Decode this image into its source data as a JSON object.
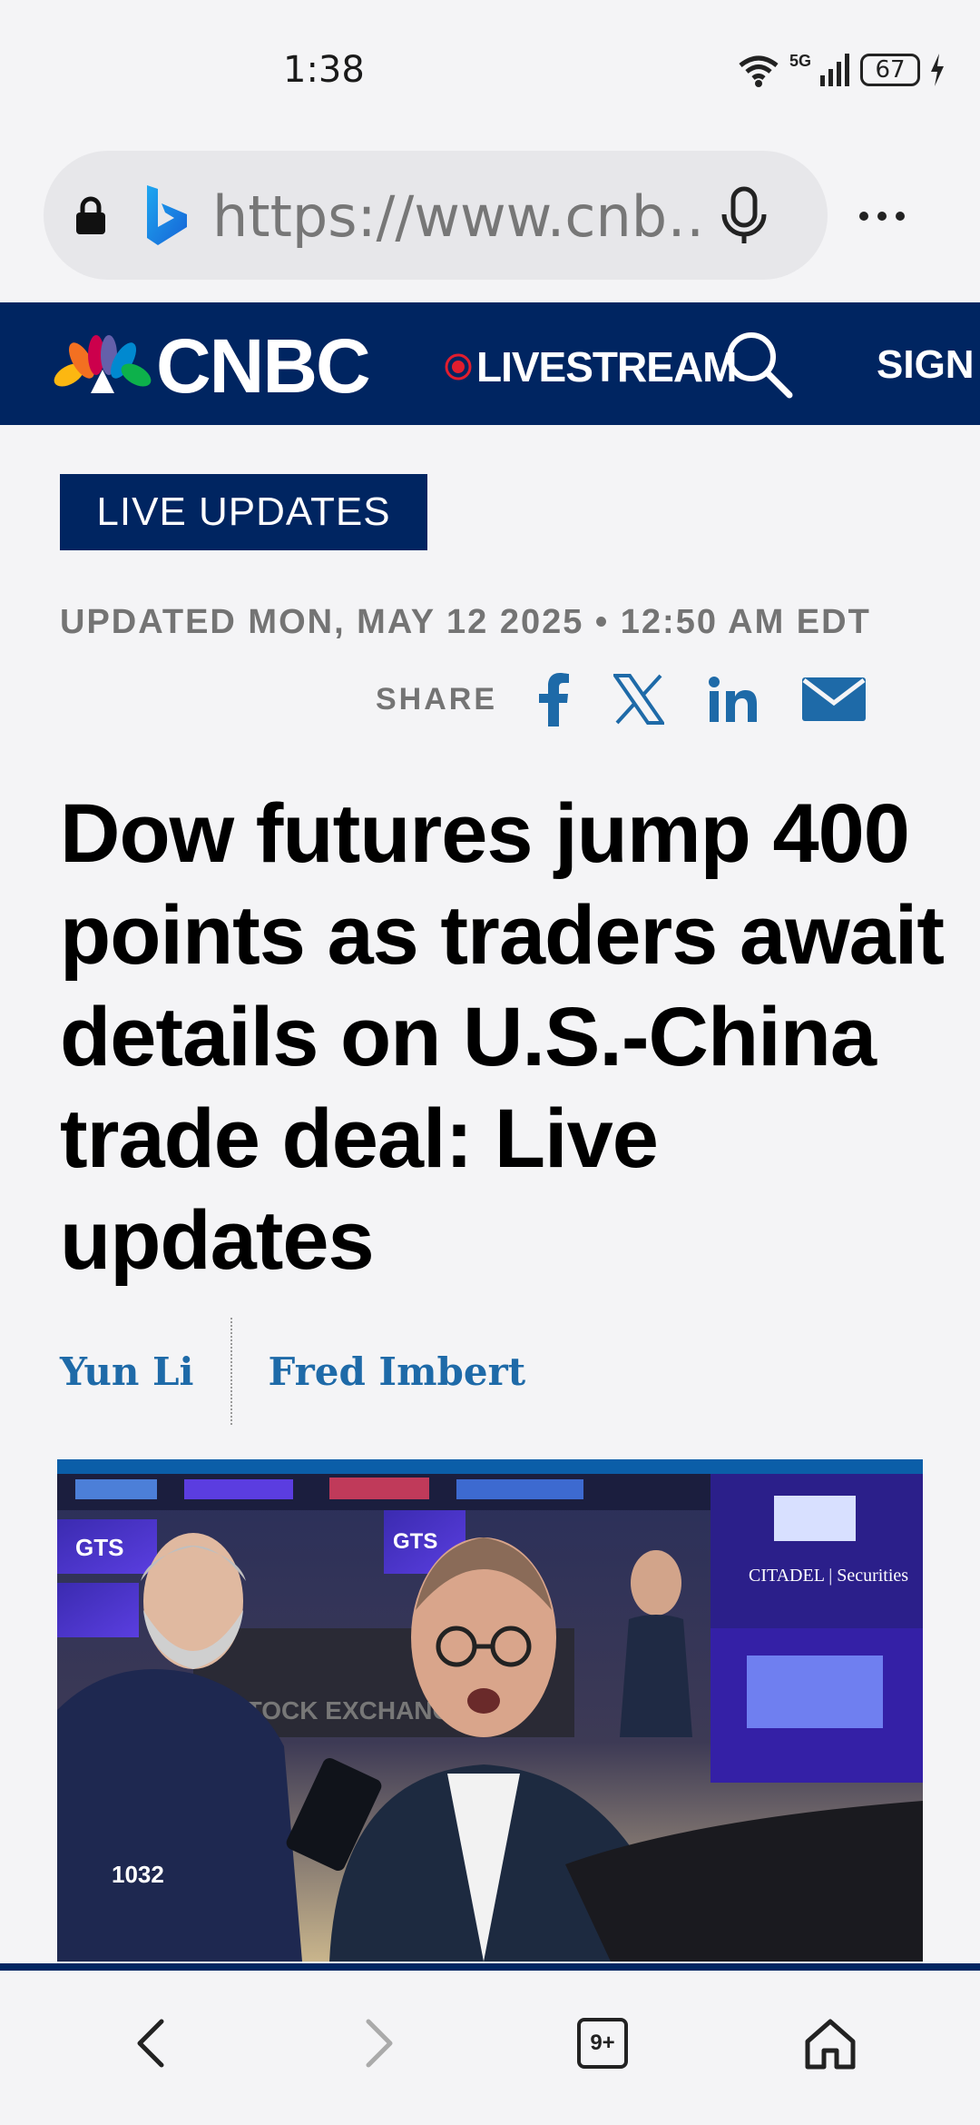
{
  "status_bar": {
    "time": "1:38",
    "network": "5G",
    "battery": "67"
  },
  "browser": {
    "url": "https://www.cnb…"
  },
  "site_nav": {
    "brand": "CNBC",
    "livestream": "LIVESTREAM",
    "signin": "SIGN IN"
  },
  "article": {
    "badge": "LIVE UPDATES",
    "updated": "UPDATED MON, MAY 12 2025 • 12:50 AM EDT",
    "share_label": "SHARE",
    "headline": "Dow futures jump 400 points as traders await details on U.S.-China trade deal: Live updates",
    "authors": [
      "Yun Li",
      "Fred Imbert"
    ]
  },
  "photo": {
    "sign_gts": "GTS",
    "sign_citadel": "CITADEL | Securities",
    "sign_exchange": "STOCK EXCHANGE",
    "badge_number": "1032"
  },
  "bottom_nav": {
    "tabs": "9+"
  },
  "colors": {
    "brand_navy": "#002561",
    "author_link": "#1e6aa8",
    "status_red": "#e11d2e"
  }
}
